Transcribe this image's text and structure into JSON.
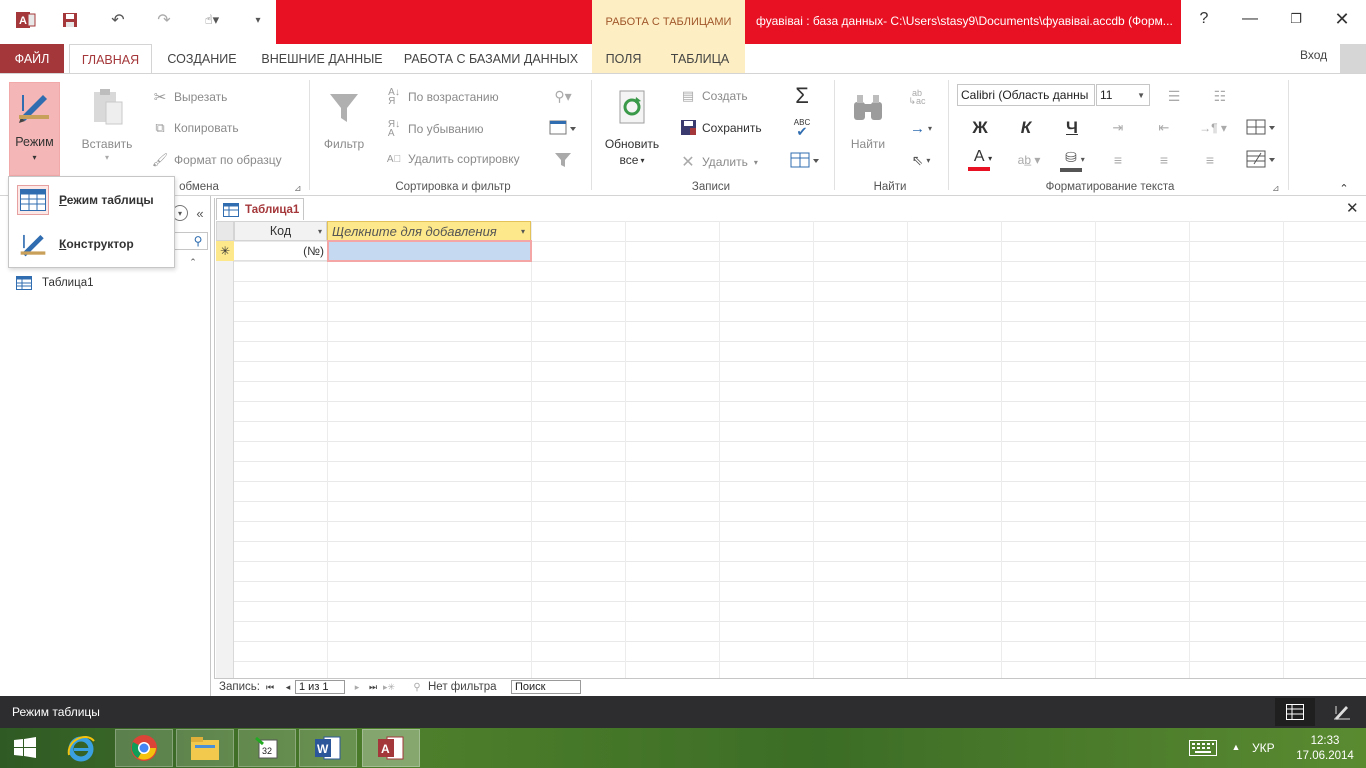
{
  "window": {
    "context_group": "РАБОТА С ТАБЛИЦАМИ",
    "title": "фуавіваі : база данных- C:\\Users\\stasy9\\Documents\\фуавіваі.accdb (Форм..."
  },
  "tabs": {
    "file": "ФАЙЛ",
    "home": "ГЛАВНАЯ",
    "create": "СОЗДАНИЕ",
    "external": "ВНЕШНИЕ ДАННЫЕ",
    "database": "РАБОТА С БАЗАМИ ДАННЫХ",
    "fields": "ПОЛЯ",
    "table": "ТАБЛИЦА",
    "signin": "Вход"
  },
  "ribbon": {
    "views": {
      "mode": "Режим"
    },
    "clipboard": {
      "paste": "Вставить",
      "cut": "Вырезать",
      "copy": "Копировать",
      "format_painter": "Формат по образцу",
      "label": "обмена"
    },
    "sort_filter": {
      "filter": "Фильтр",
      "ascending": "По возрастанию",
      "descending": "По убыванию",
      "remove_sort": "Удалить сортировку",
      "label": "Сортировка и фильтр"
    },
    "records": {
      "refresh_line1": "Обновить",
      "refresh_line2": "все",
      "new": "Создать",
      "save": "Сохранить",
      "delete": "Удалить",
      "label": "Записи"
    },
    "find": {
      "find": "Найти",
      "label": "Найти"
    },
    "text_format": {
      "font": "Calibri (Область данны",
      "size": "11",
      "bold": "Ж",
      "italic": "К",
      "underline": "Ч",
      "label": "Форматирование текста"
    }
  },
  "mode_menu": {
    "datasheet": "Режим таблицы",
    "datasheet_underline": "Р",
    "datasheet_rest": "ежим таблицы",
    "design": "Конструктор",
    "design_underline": "К",
    "design_rest": "онструктор"
  },
  "nav_pane": {
    "items": [
      {
        "label": "Таблица1"
      }
    ]
  },
  "document": {
    "tab_label": "Таблица1",
    "columns": [
      "Код",
      "Щелкните для добавления"
    ],
    "new_row_marker": "✳",
    "new_row_id": "(№)"
  },
  "record_nav": {
    "label": "Запись:",
    "position": "1 из 1",
    "filter_status": "Нет фильтра",
    "search_placeholder": "Поиск"
  },
  "status": {
    "text": "Режим таблицы"
  },
  "taskbar": {
    "lang": "УКР",
    "time": "12:33",
    "date": "17.06.2014"
  },
  "colors": {
    "access_accent": "#a4373a",
    "title_red": "#e81123",
    "context_yellow": "#fdefc3",
    "selected_cell": "#c5d9f1"
  }
}
